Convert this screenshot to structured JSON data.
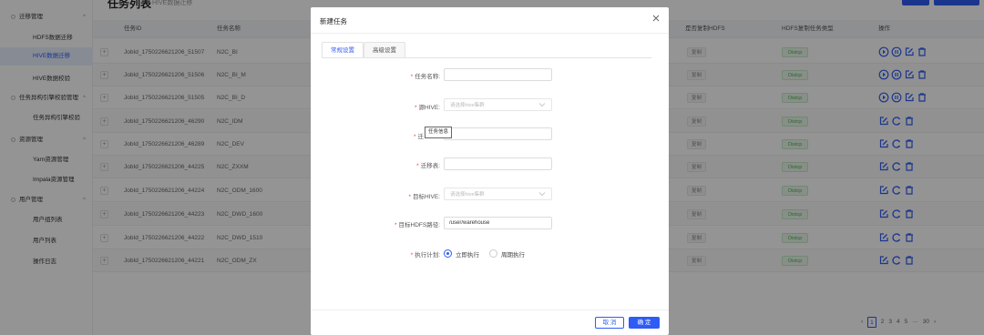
{
  "sidebar": {
    "groups": [
      {
        "label": "迁移管理",
        "items": [
          "HDFS数据迁移",
          "HIVE数据迁移",
          "HIVE数据校验"
        ]
      },
      {
        "label": "任务异构引擎校验管理",
        "items": [
          "任务异构引擎校验"
        ]
      },
      {
        "label": "资源管理",
        "items": [
          "Yarn资源管理",
          "Impala资源管理"
        ]
      },
      {
        "label": "用户管理",
        "items": [
          "用户组列表",
          "用户列表",
          "操作日志"
        ]
      }
    ],
    "active_item": "HIVE数据迁移"
  },
  "header": {
    "title": "任务列表",
    "subtitle": "HIVE数据迁移"
  },
  "table": {
    "columns": [
      "任务ID",
      "任务名称",
      "是否复制HDFS",
      "HDFS复制任务类型",
      "操作"
    ],
    "rows": [
      {
        "id": "JobId_1750226621206_51507",
        "name": "N2C_BI",
        "copy": "复制",
        "type": "Distcp",
        "actions": "full"
      },
      {
        "id": "JobId_1750226621206_51506",
        "name": "N2C_BI_M",
        "copy": "复制",
        "type": "Distcp",
        "actions": "full"
      },
      {
        "id": "JobId_1750226621206_51505",
        "name": "N2C_BI_D",
        "copy": "复制",
        "type": "Distcp",
        "actions": "full"
      },
      {
        "id": "JobId_1750226621206_46290",
        "name": "N2C_IDM",
        "copy": "复制",
        "type": "Distcp",
        "actions": "short"
      },
      {
        "id": "JobId_1750226621206_46289",
        "name": "N2C_DEV",
        "copy": "复制",
        "type": "Distcp",
        "actions": "short"
      },
      {
        "id": "JobId_1750226621206_44225",
        "name": "N2C_ZXXM",
        "copy": "复制",
        "type": "Distcp",
        "actions": "short"
      },
      {
        "id": "JobId_1750226621206_44224",
        "name": "N2C_ODM_1600",
        "copy": "复制",
        "type": "Distcp",
        "actions": "short"
      },
      {
        "id": "JobId_1750226621206_44223",
        "name": "N2C_DWD_1600",
        "copy": "复制",
        "type": "Distcp",
        "actions": "short"
      },
      {
        "id": "JobId_1750226621206_44222",
        "name": "N2C_DWD_1510",
        "copy": "复制",
        "type": "Distcp",
        "actions": "short"
      },
      {
        "id": "JobId_1750226621206_44221",
        "name": "N2C_ODM_ZX",
        "copy": "复制",
        "type": "Distcp",
        "actions": "short"
      }
    ]
  },
  "pagination": {
    "current": "1",
    "pages": [
      "2",
      "3",
      "4",
      "5",
      "···",
      "30"
    ],
    "prev": "‹",
    "next": "›"
  },
  "dialog": {
    "title": "新建任务",
    "tabs": [
      "常规设置",
      "高级设置"
    ],
    "fields": {
      "task_name": {
        "label": "任务名称:",
        "value": ""
      },
      "source_hive": {
        "label": "源HIVE:",
        "placeholder": "请选择hive集群"
      },
      "migrate_db": {
        "label": "迁",
        "value": ""
      },
      "tooltip": "任务信息",
      "migrate_table": {
        "label": "迁移表:",
        "value": ""
      },
      "target_hive": {
        "label": "目标HIVE:",
        "placeholder": "请选择hive集群"
      },
      "target_hdfs": {
        "label": "目标HDFS路径:",
        "value": "/user/warehouse"
      },
      "plan": {
        "label": "执行计划:",
        "options": [
          "立即执行",
          "周期执行"
        ],
        "selected": "立即执行"
      }
    },
    "buttons": {
      "cancel": "取 消",
      "ok": "确 定"
    }
  },
  "colors": {
    "primary": "#2f5cf5",
    "required": "#f44336",
    "success": "#4caf50"
  }
}
